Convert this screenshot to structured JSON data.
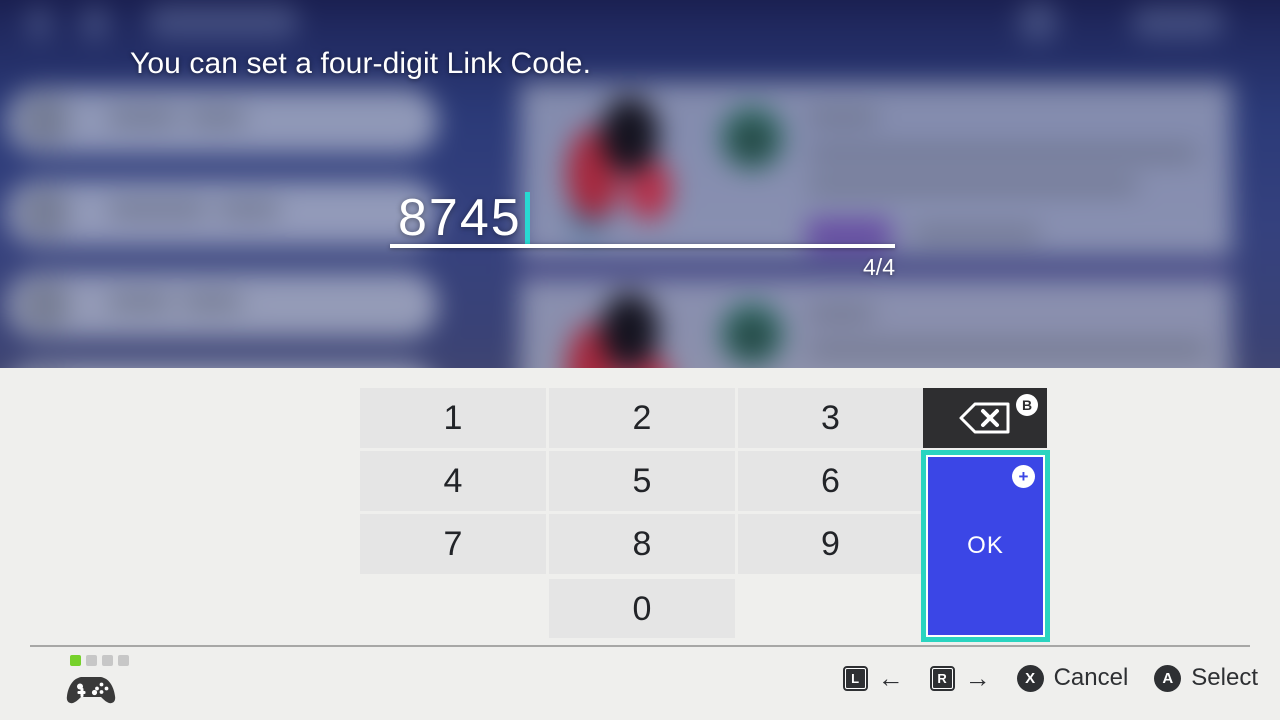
{
  "prompt": {
    "text": "You can set a four-digit Link Code."
  },
  "input": {
    "value": "8745",
    "counter": "4/4",
    "caret_color": "#28d9d2",
    "underline_color": "#ffffff"
  },
  "keypad": {
    "rows": [
      [
        {
          "label": "1",
          "name": "key-1"
        },
        {
          "label": "2",
          "name": "key-2"
        },
        {
          "label": "3",
          "name": "key-3"
        }
      ],
      [
        {
          "label": "4",
          "name": "key-4"
        },
        {
          "label": "5",
          "name": "key-5"
        },
        {
          "label": "6",
          "name": "key-6"
        }
      ],
      [
        {
          "label": "7",
          "name": "key-7"
        },
        {
          "label": "8",
          "name": "key-8"
        },
        {
          "label": "9",
          "name": "key-9"
        }
      ],
      [
        {
          "label": "",
          "name": "key-blank-left"
        },
        {
          "label": "0",
          "name": "key-0"
        },
        {
          "label": "",
          "name": "key-blank-right"
        }
      ]
    ],
    "key_fill": "#e5e5e5",
    "key_text_color": "#222428"
  },
  "backspace": {
    "icon": "backspace-icon",
    "badge": "B",
    "fill": "#2e2e30"
  },
  "ok": {
    "label": "OK",
    "badge": "+",
    "fill": "#3b46e6",
    "selection_color": "#2ad4c0",
    "selected": true
  },
  "footer": {
    "player_indicators": [
      {
        "active": true
      },
      {
        "active": false
      },
      {
        "active": false
      },
      {
        "active": false
      }
    ],
    "controller_icon": "gamepad-icon",
    "active_color": "#76d12b",
    "hints": [
      {
        "button": "L",
        "shape": "square",
        "label": "←",
        "label_is_arrow": true,
        "name": "hint-prev"
      },
      {
        "button": "R",
        "shape": "square",
        "label": "→",
        "label_is_arrow": true,
        "name": "hint-next"
      },
      {
        "button": "X",
        "shape": "round",
        "label": "Cancel",
        "label_is_arrow": false,
        "name": "hint-cancel"
      },
      {
        "button": "A",
        "shape": "round",
        "label": "Select",
        "label_is_arrow": false,
        "name": "hint-select"
      }
    ]
  },
  "background": {
    "top_bar_color": "#191e4e",
    "panel_color": "#2b3a78",
    "keyboard_color": "#efefed",
    "description": "blurred game menu behind keyboard overlay"
  }
}
